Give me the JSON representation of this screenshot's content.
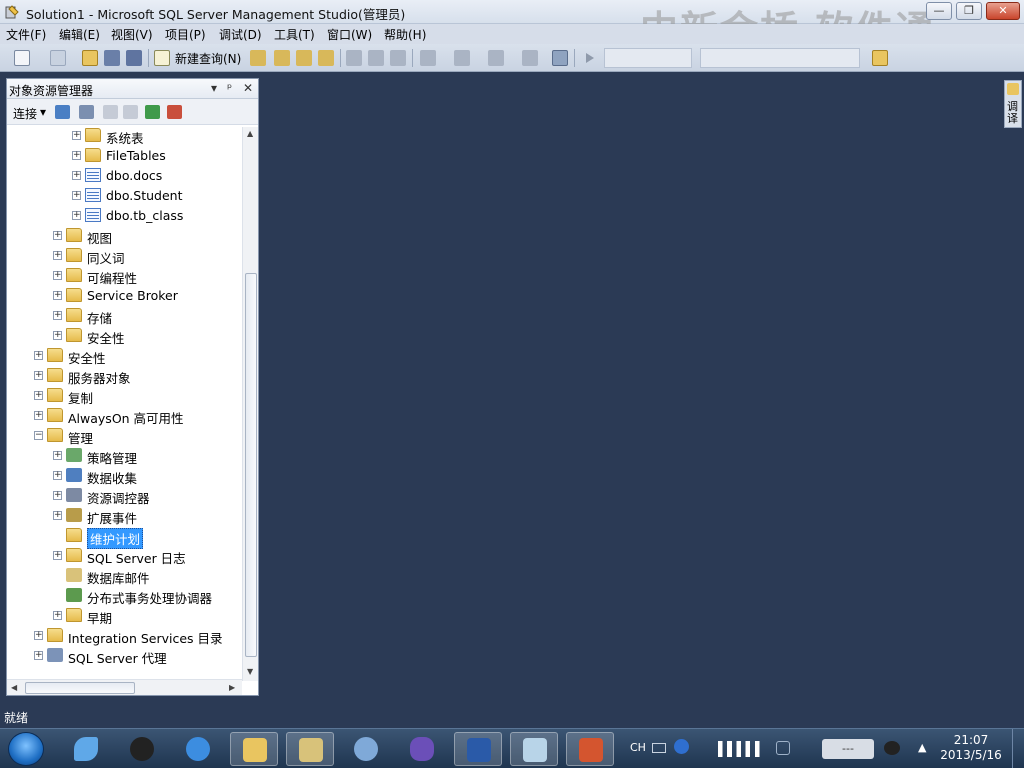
{
  "window": {
    "title": "Solution1 - Microsoft SQL Server Management Studio(管理员)",
    "watermark": "中新金桥 软件通",
    "minimize": "—",
    "maximize": "❐",
    "close": "✕"
  },
  "menu": [
    "文件(F)",
    "编辑(E)",
    "视图(V)",
    "项目(P)",
    "调试(D)",
    "工具(T)",
    "窗口(W)",
    "帮助(H)"
  ],
  "toolbar": {
    "new_query_label": "新建查询(N)"
  },
  "object_explorer": {
    "title": "对象资源管理器",
    "pin": "ᵖ",
    "dropdown": "▾",
    "close": "✕",
    "connect_label": "连接",
    "tree": [
      {
        "label": "系统表",
        "icon": "folder-icon",
        "expander": "+"
      },
      {
        "label": "FileTables",
        "icon": "folder-icon",
        "expander": "+"
      },
      {
        "label": "dbo.docs",
        "icon": "table-icon",
        "expander": "+"
      },
      {
        "label": "dbo.Student",
        "icon": "table-icon",
        "expander": "+"
      },
      {
        "label": "dbo.tb_class",
        "icon": "table-icon",
        "expander": "+"
      },
      {
        "label": "视图",
        "icon": "folder-icon",
        "expander": "+"
      },
      {
        "label": "同义词",
        "icon": "folder-icon",
        "expander": "+"
      },
      {
        "label": "可编程性",
        "icon": "folder-icon",
        "expander": "+"
      },
      {
        "label": "Service Broker",
        "icon": "folder-icon",
        "expander": "+"
      },
      {
        "label": "存储",
        "icon": "folder-icon",
        "expander": "+"
      },
      {
        "label": "安全性",
        "icon": "folder-icon",
        "expander": "+"
      },
      {
        "label": "安全性",
        "icon": "folder-icon",
        "expander": "+"
      },
      {
        "label": "服务器对象",
        "icon": "folder-icon",
        "expander": "+"
      },
      {
        "label": "复制",
        "icon": "folder-icon",
        "expander": "+"
      },
      {
        "label": "AlwaysOn 高可用性",
        "icon": "folder-icon",
        "expander": "+"
      },
      {
        "label": "管理",
        "icon": "folder-icon",
        "expander": "−"
      },
      {
        "label": "策略管理",
        "icon": "policy-icon",
        "expander": "+"
      },
      {
        "label": "数据收集",
        "icon": "data-collection-icon",
        "expander": "+"
      },
      {
        "label": "资源调控器",
        "icon": "resource-governor-icon",
        "expander": "+"
      },
      {
        "label": "扩展事件",
        "icon": "extended-events-icon",
        "expander": "+"
      },
      {
        "label": "维护计划",
        "icon": "folder-icon",
        "expander": "",
        "selected": true
      },
      {
        "label": "SQL Server 日志",
        "icon": "folder-icon",
        "expander": "+"
      },
      {
        "label": "数据库邮件",
        "icon": "mail-icon",
        "expander": ""
      },
      {
        "label": "分布式事务处理协调器",
        "icon": "dtc-icon",
        "expander": ""
      },
      {
        "label": "早期",
        "icon": "folder-icon",
        "expander": "+"
      },
      {
        "label": "Integration Services 目录",
        "icon": "folder-icon",
        "expander": "+"
      },
      {
        "label": "SQL Server 代理",
        "icon": "agent-icon",
        "expander": "+"
      }
    ]
  },
  "side_tab": "调译",
  "status": "就绪",
  "taskbar": {
    "input_lang": "CH",
    "clock_time": "21:07",
    "clock_date": "2013/5/16",
    "battery": "---"
  },
  "colors": {
    "workspace": "#2b3a55",
    "selection": "#3399ff",
    "folder": "#e6bb4c"
  }
}
